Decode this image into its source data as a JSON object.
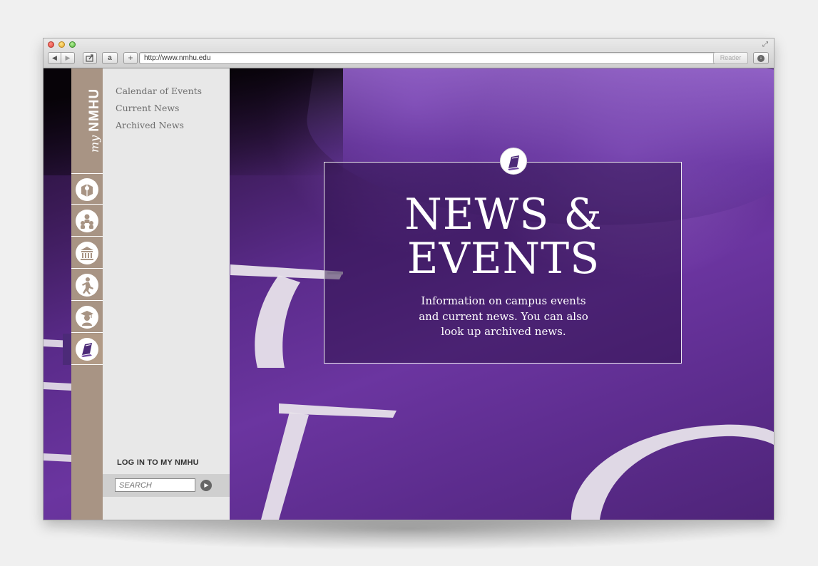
{
  "browser": {
    "url": "http://www.nmhu.edu",
    "reader_label": "Reader",
    "amazon_label": "a",
    "plus_label": "+"
  },
  "brand": {
    "my": "my",
    "name": "NMHU"
  },
  "rail": {
    "items": [
      {
        "icon": "admissions-icon"
      },
      {
        "icon": "people-icon"
      },
      {
        "icon": "building-icon"
      },
      {
        "icon": "athletics-icon"
      },
      {
        "icon": "graduate-icon"
      },
      {
        "icon": "news-icon",
        "active": true
      }
    ],
    "active_color": "#4c2a78"
  },
  "sub_nav": {
    "links": [
      "Calendar of Events",
      "Current News",
      "Archived News"
    ],
    "login_label": "LOG IN TO MY NMHU",
    "search_placeholder": "SEARCH"
  },
  "hero": {
    "title_line1": "NEWS &",
    "title_line2": "EVENTS",
    "description": "Information on campus events and current news. You can also look up archived news."
  },
  "colors": {
    "purple": "#5a2b8a",
    "rail": "#a89484",
    "panel": "#e8e8e8"
  }
}
